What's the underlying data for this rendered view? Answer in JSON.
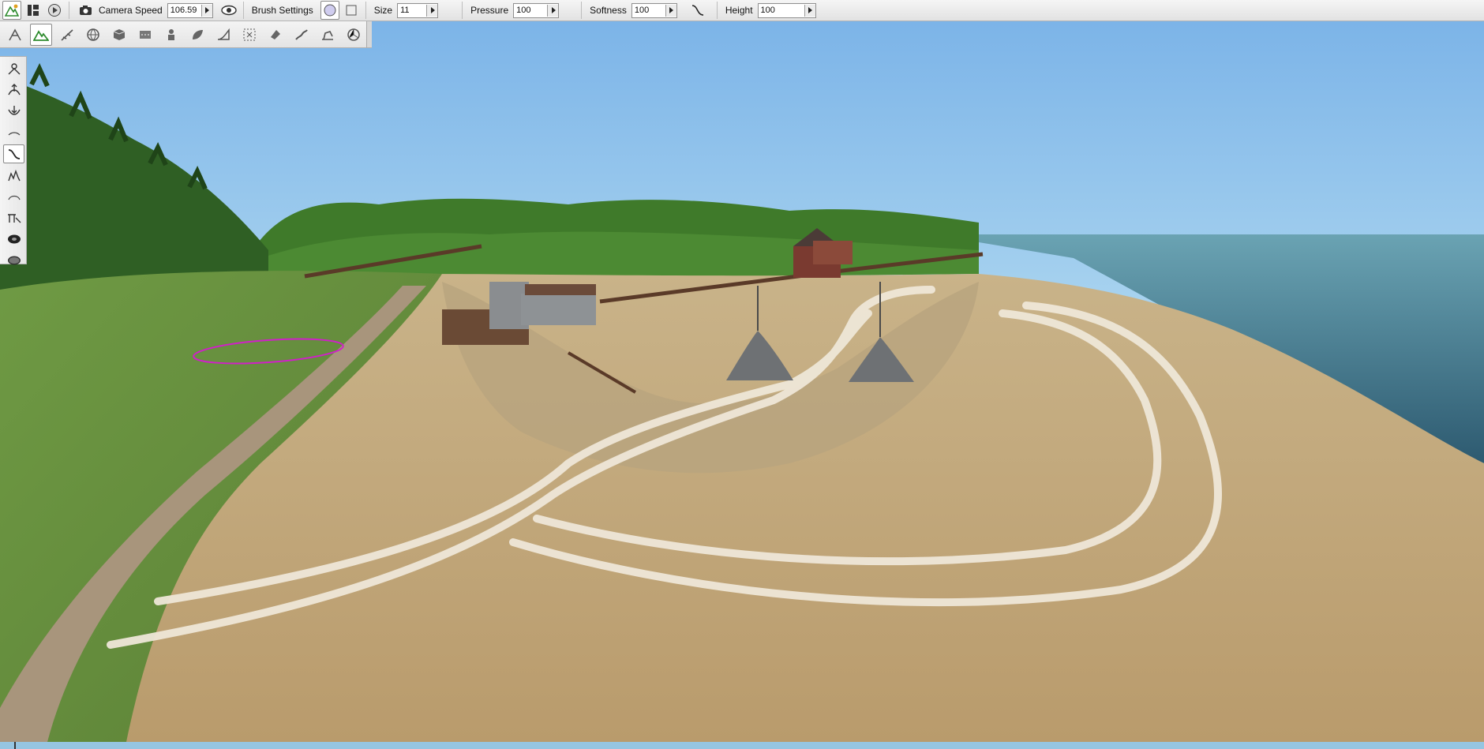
{
  "toolbar": {
    "camera_speed_label": "Camera Speed",
    "camera_speed_value": "106.59",
    "brush_settings_label": "Brush Settings",
    "size_label": "Size",
    "size_value": "11",
    "pressure_label": "Pressure",
    "pressure_value": "100",
    "softness_label": "Softness",
    "softness_value": "100",
    "height_label": "Height",
    "height_value": "100"
  },
  "colors": {
    "accent_green": "#2e8b2e",
    "brush_outline": "#d020c8",
    "sky_top": "#7fb7ea",
    "sea": "#3f6f82"
  },
  "icons": {
    "top": [
      "terrain-editor-icon",
      "layout-icon",
      "play-icon",
      "camera-icon",
      "eye-icon",
      "circle-brush-icon",
      "square-brush-icon",
      "softness-curve-icon"
    ],
    "second_row": [
      "object-icon",
      "terrain-icon",
      "road-icon",
      "sphere-icon",
      "cube-icon",
      "path-icon",
      "spawn-icon",
      "leaf-icon",
      "ramp-icon",
      "selection-icon",
      "light-icon",
      "river-icon",
      "decal-icon",
      "shape-icon"
    ],
    "left": [
      "raise-icon",
      "lower-icon",
      "smooth-icon",
      "flatten-icon",
      "curve-icon",
      "noise-icon",
      "set-height-icon",
      "slope-icon",
      "paint-icon",
      "erase-icon"
    ]
  }
}
